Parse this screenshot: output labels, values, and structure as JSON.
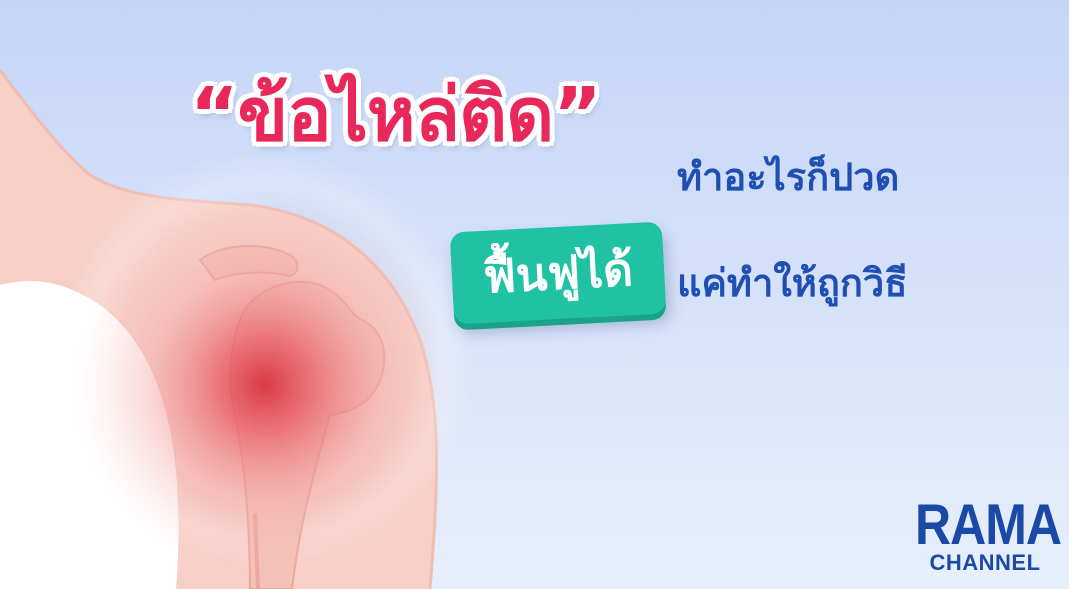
{
  "headline": {
    "main": "“ข้อไหล่ติด”",
    "sub": "ทำอะไรก็ปวด"
  },
  "badge": {
    "label": "ฟื้นฟูได้"
  },
  "subline2": "แค่ทำให้ถูกวิธี",
  "logo": {
    "top": "RAMA",
    "bottom": "CHANNEL"
  },
  "colors": {
    "background_top": "#c7d7f7",
    "background_bottom": "#e6eefc",
    "headline": "#e8285a",
    "subtext": "#1f4fb3",
    "badge": "#21c2a4",
    "logo": "#1a4aa6"
  },
  "illustration": "shoulder-pain-illustration"
}
